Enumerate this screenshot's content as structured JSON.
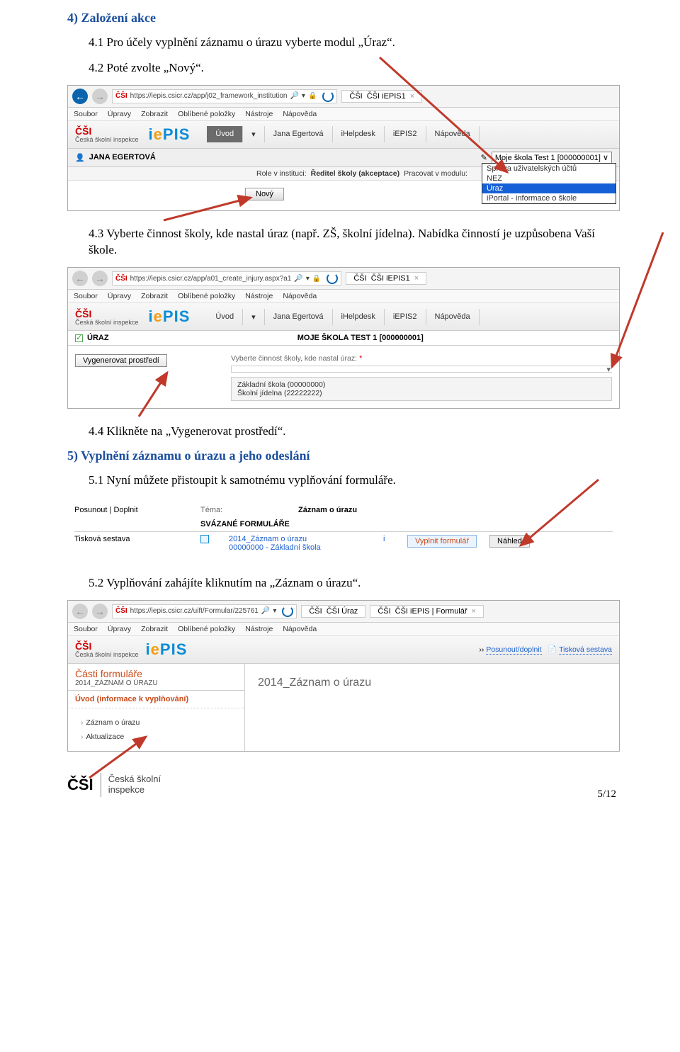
{
  "h4": "4) Založení akce",
  "p41": "4.1 Pro účely vyplnění záznamu o úrazu vyberte modul „Úraz“.",
  "p42": "4.2 Poté zvolte „Nový“.",
  "p43": "4.3 Vyberte činnost školy, kde nastal úraz (např. ZŠ, školní jídelna). Nabídka činností je uzpůsobena Vaší škole.",
  "p44": "4.4 Klikněte na „Vygenerovat prostředí“.",
  "h5": "5) Vyplnění záznamu o úrazu a jeho odeslání",
  "p51": "5.1 Nyní můžete přistoupit k samotnému vyplňování formuláře.",
  "p52": "5.2 Vyplňování zahájíte kliknutím na „Záznam o úrazu“.",
  "ie_menu": [
    "Soubor",
    "Úpravy",
    "Zobrazit",
    "Oblíbené položky",
    "Nástroje",
    "Nápověda"
  ],
  "shot1": {
    "url": "https://iepis.csicr.cz/app/j02_framework_institution",
    "tab": "ČŠI iEPIS1",
    "csi_label": "Česká školní inspekce",
    "logo": "iePIS",
    "nav": [
      "Úvod",
      "Jana Egertová",
      "iHelpdesk",
      "iEPIS2",
      "Nápověda"
    ],
    "user": "JANA EGERTOVÁ",
    "select": "Moje škola Test 1 [000000001]",
    "role_label": "Role v instituci:",
    "role_value": "Ředitel školy (akceptace)",
    "module_label": "Pracovat v modulu:",
    "menu": [
      "Správa uživatelských účtů",
      "NEZ",
      "Úraz",
      "iPortal - informace o škole"
    ],
    "new_btn": "Nový"
  },
  "shot2": {
    "url": "https://iepis.csicr.cz/app/a01_create_injury.aspx?a1",
    "tab": "ČŠI iEPIS1",
    "title": "ÚRAZ",
    "school": "MOJE ŠKOLA TEST 1 [000000001]",
    "gen_btn": "Vygenerovat prostředí",
    "choose_label": "Vyberte činnost školy, kde nastal úraz:",
    "opt1": "Základní škola (00000000)",
    "opt2": "Školní jídelna (22222222)"
  },
  "shot3": {
    "posunout": "Posunout | Doplnit",
    "tiskova": "Tisková sestava",
    "tema_label": "Téma:",
    "tema_value": "Záznam o úrazu",
    "svazane": "SVÁZANÉ FORMULÁŘE",
    "form_name": "2014_Záznam o úrazu",
    "form_sub": "00000000 - Základní škola",
    "vyplnit": "Vyplnit formulář",
    "nahled": "Náhled"
  },
  "shot4": {
    "url": "https://iepis.csicr.cz/uift/Formular/225761",
    "tab1": "ČŠI Úraz",
    "tab2": "ČŠI iEPIS | Formulář",
    "bc1": "Posunout/doplnit",
    "bc2": "Tisková sestava",
    "side_title": "Části formuláře",
    "side_sub": "2014_ZÁZNAM O ÚRAZU",
    "page_title": "2014_Záznam o úrazu",
    "sec1": "Úvod (informace k vyplňování)",
    "item1": "Záznam o úrazu",
    "item2": "Aktualizace"
  },
  "footer": {
    "csi": "ČŠI",
    "l1": "Česká školní",
    "l2": "inspekce"
  },
  "page": "5/12"
}
